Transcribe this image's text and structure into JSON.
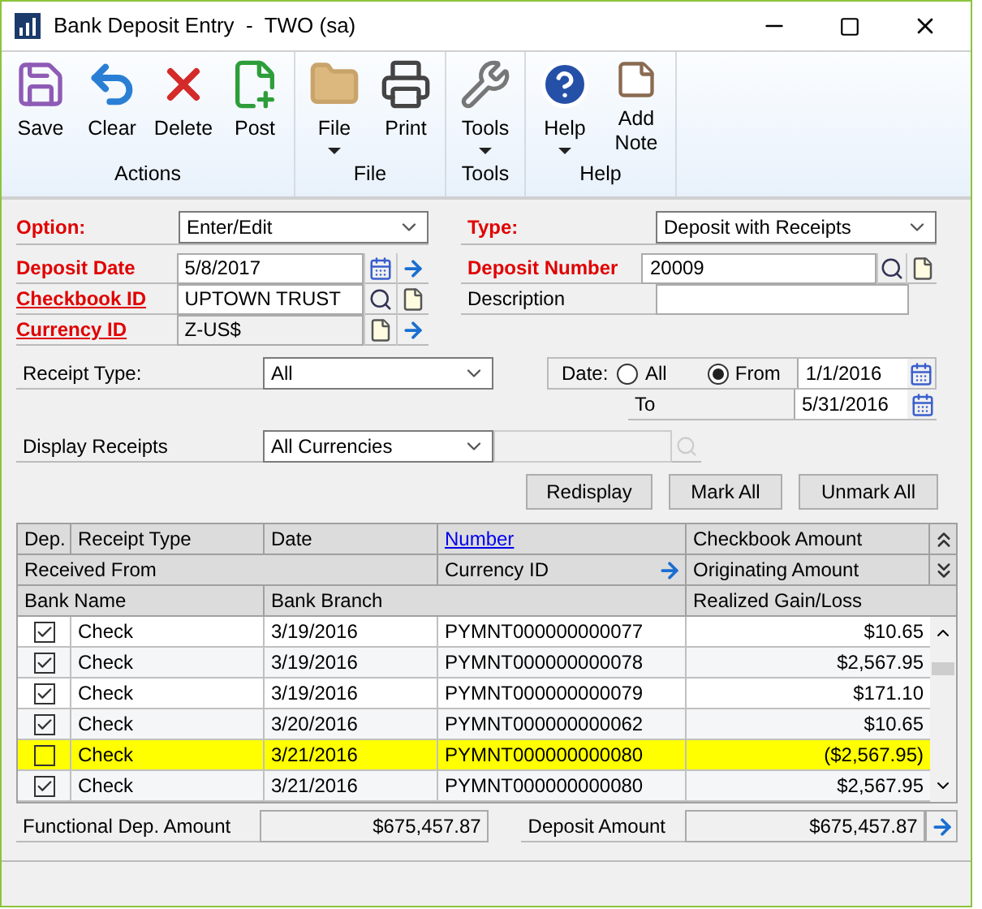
{
  "window": {
    "title": "Bank Deposit Entry  -  TWO (sa)"
  },
  "toolbar": {
    "groups": [
      {
        "label": "Actions",
        "buttons": [
          {
            "kind": "save",
            "label": "Save",
            "dropdown": false
          },
          {
            "kind": "clear",
            "label": "Clear",
            "dropdown": false
          },
          {
            "kind": "delete",
            "label": "Delete",
            "dropdown": false
          },
          {
            "kind": "post",
            "label": "Post",
            "dropdown": false
          }
        ]
      },
      {
        "label": "File",
        "buttons": [
          {
            "kind": "file",
            "label": "File",
            "dropdown": true
          },
          {
            "kind": "print",
            "label": "Print",
            "dropdown": false
          }
        ]
      },
      {
        "label": "Tools",
        "buttons": [
          {
            "kind": "tools",
            "label": "Tools",
            "dropdown": true
          }
        ]
      },
      {
        "label": "Help",
        "buttons": [
          {
            "kind": "help",
            "label": "Help",
            "dropdown": true
          },
          {
            "kind": "note",
            "label": "Add Note",
            "dropdown": false
          }
        ]
      }
    ]
  },
  "option": {
    "label": "Option:",
    "kind": "required",
    "value": "Enter/Edit"
  },
  "type": {
    "label": "Type:",
    "kind": "required",
    "value": "Deposit with Receipts"
  },
  "deposit_date": {
    "label": "Deposit Date",
    "kind": "required",
    "value": "5/8/2017"
  },
  "deposit_number": {
    "label": "Deposit Number",
    "kind": "required",
    "value": "20009"
  },
  "checkbook_id": {
    "label": "Checkbook ID",
    "kind": "link",
    "value": "UPTOWN TRUST"
  },
  "description": {
    "label": "Description",
    "kind": "plain"
  },
  "currency_id": {
    "label": "Currency ID",
    "kind": "link",
    "value": "Z-US$"
  },
  "receipt_type": {
    "label": "Receipt Type:",
    "value": "All"
  },
  "date_filter": {
    "label": "Date:",
    "options": [
      {
        "label": "All",
        "selected": false
      },
      {
        "label": "From",
        "selected": true
      }
    ],
    "from": "1/1/2016",
    "to_label": "To",
    "to": "5/31/2016"
  },
  "display_receipts": {
    "label": "Display Receipts",
    "value": "All Currencies"
  },
  "buttons": [
    "Redisplay",
    "Mark All",
    "Unmark All"
  ],
  "grid": {
    "header_row_1": [
      "Dep.",
      "Receipt Type",
      "Date",
      "Number",
      "Checkbook Amount"
    ],
    "header_row_2": [
      "Received From",
      "Currency ID",
      "Originating Amount"
    ],
    "header_row_3": [
      "Bank Name",
      "Bank Branch",
      "Realized Gain/Loss"
    ],
    "rows": [
      {
        "checked": true,
        "type": "Check",
        "date": "3/19/2016",
        "number": "PYMNT000000000077",
        "amount": "$10.65",
        "highlighted": false
      },
      {
        "checked": true,
        "type": "Check",
        "date": "3/19/2016",
        "number": "PYMNT000000000078",
        "amount": "$2,567.95",
        "highlighted": false
      },
      {
        "checked": true,
        "type": "Check",
        "date": "3/19/2016",
        "number": "PYMNT000000000079",
        "amount": "$171.10",
        "highlighted": false
      },
      {
        "checked": true,
        "type": "Check",
        "date": "3/20/2016",
        "number": "PYMNT000000000062",
        "amount": "$10.65",
        "highlighted": false
      },
      {
        "checked": false,
        "type": "Check",
        "date": "3/21/2016",
        "number": "PYMNT000000000080",
        "amount": "($2,567.95)",
        "highlighted": true
      },
      {
        "checked": true,
        "type": "Check",
        "date": "3/21/2016",
        "number": "PYMNT000000000080",
        "amount": "$2,567.95",
        "highlighted": false
      }
    ]
  },
  "functional_amount": {
    "label": "Functional Dep. Amount",
    "value": "$675,457.87"
  },
  "deposit_amount": {
    "label": "Deposit Amount",
    "value": "$675,457.87"
  }
}
